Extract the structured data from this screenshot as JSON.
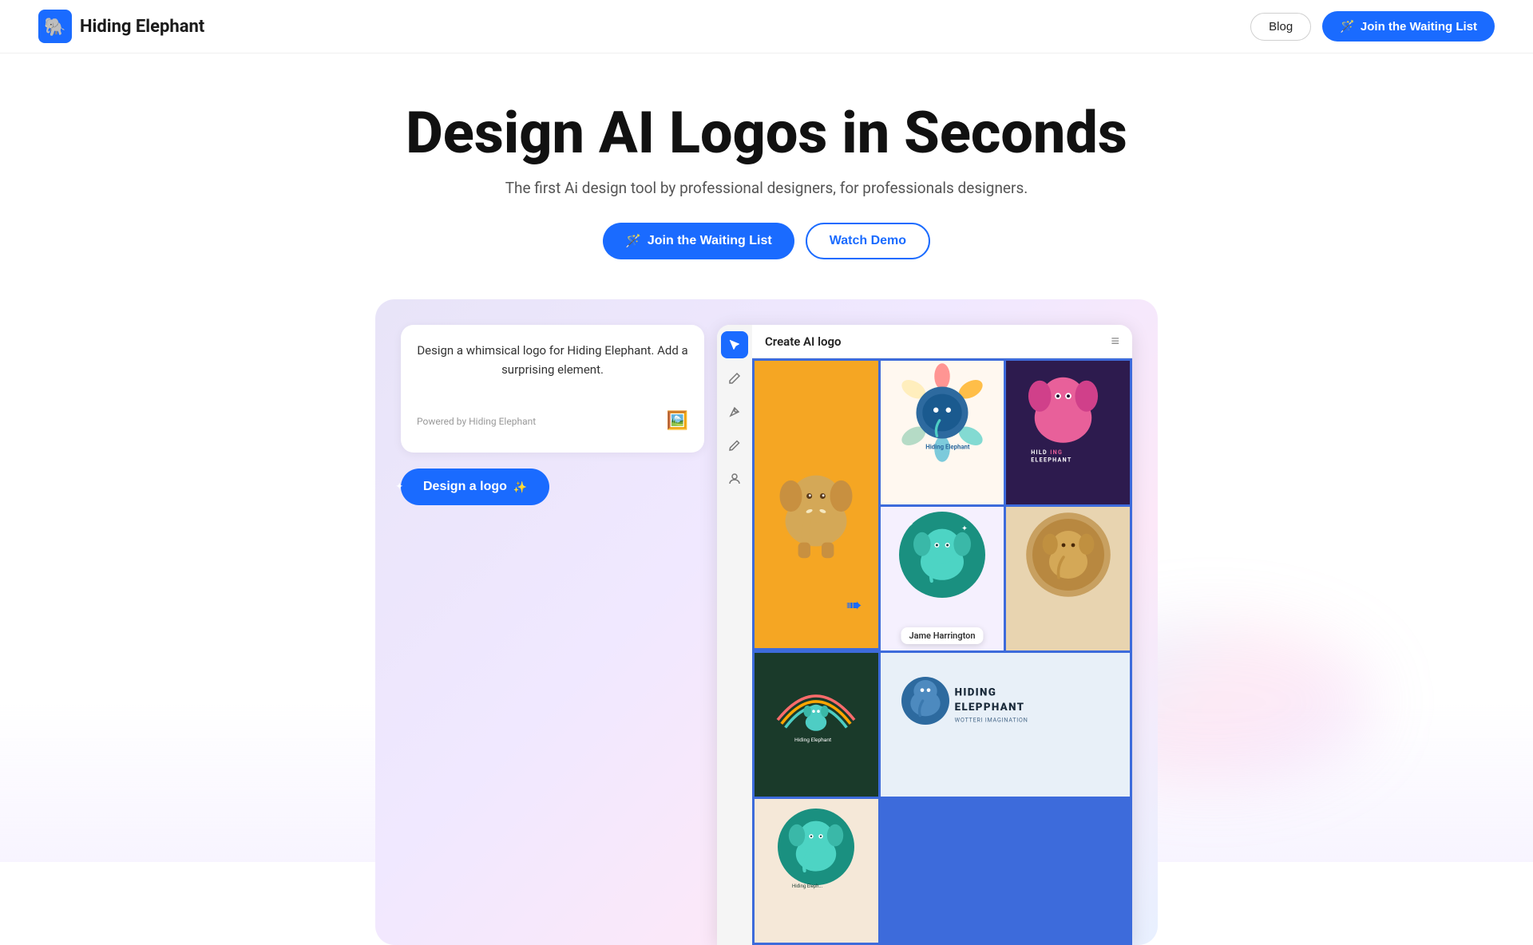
{
  "nav": {
    "brand": "Hiding Elephant",
    "blog_label": "Blog",
    "waiting_label": "Join the Waiting List"
  },
  "hero": {
    "title": "Design AI Logos in Seconds",
    "subtitle": "The first Ai design tool by professional designers, for professionals designers.",
    "btn_waiting": "Join the Waiting List",
    "btn_demo": "Watch Demo"
  },
  "demo": {
    "chat_text": "Design a whimsical logo for Hiding Elephant. Add a surprising element.",
    "powered_by": "Powered by Hiding Elephant",
    "design_btn": "Design a logo",
    "canvas_title": "Create AI logo",
    "tooltip_name": "Jame Harrington"
  },
  "colors": {
    "primary": "#1a6bff",
    "orange_cell": "#f5a623",
    "teal_dark": "#1a4a3a",
    "grid_bg": "#3d6bdb"
  }
}
